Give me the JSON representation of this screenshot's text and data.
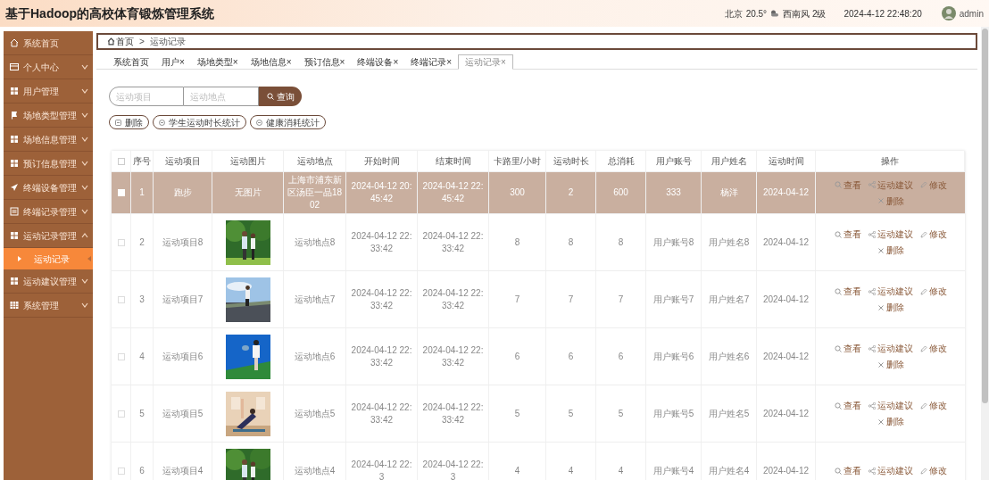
{
  "header": {
    "title": "基于Hadoop的高校体育锻炼管理系统",
    "city": "北京",
    "temperature": "20.5°",
    "wind": "西南风 2级",
    "datetime": "2024-4-12 22:48:20",
    "user": "admin"
  },
  "sidebar": {
    "items": [
      {
        "label": "系统首页"
      },
      {
        "label": "个人中心",
        "expanded": false
      },
      {
        "label": "用户管理",
        "expanded": false
      },
      {
        "label": "场地类型管理",
        "expanded": false
      },
      {
        "label": "场地信息管理",
        "expanded": false
      },
      {
        "label": "预订信息管理",
        "expanded": false
      },
      {
        "label": "终端设备管理",
        "expanded": false
      },
      {
        "label": "终端记录管理",
        "expanded": false
      },
      {
        "label": "运动记录管理",
        "expanded": true,
        "children": [
          {
            "label": "运动记录",
            "selected": true
          }
        ]
      },
      {
        "label": "运动建议管理",
        "expanded": false
      },
      {
        "label": "系统管理",
        "expanded": false
      }
    ]
  },
  "breadcrumb": [
    "首页",
    "运动记录"
  ],
  "breadcrumb_separator": ">",
  "tabs": [
    {
      "label": "系统首页",
      "selected": false
    },
    {
      "label": "用户×",
      "selected": false
    },
    {
      "label": "场地类型×",
      "selected": false
    },
    {
      "label": "场地信息×",
      "selected": false
    },
    {
      "label": "预订信息×",
      "selected": false
    },
    {
      "label": "终端设备×",
      "selected": false
    },
    {
      "label": "终端记录×",
      "selected": false
    },
    {
      "label": "运动记录×",
      "selected": true
    }
  ],
  "search": {
    "fields": [
      {
        "placeholder": "运动项目"
      },
      {
        "placeholder": "运动地点"
      }
    ],
    "button": "查询"
  },
  "actions": [
    "删除",
    "学生运动时长统计",
    "健康消耗统计"
  ],
  "table": {
    "select_all": {
      "checked": false
    },
    "columns": [
      "序号",
      "运动项目",
      "运动图片",
      "运动地点",
      "开始时间",
      "结束时间",
      "卡路里/小时",
      "运动时长",
      "总消耗",
      "用户账号",
      "用户姓名",
      "运动时间",
      "操作"
    ],
    "rows": [
      {
        "selected": true,
        "cells": [
          "1",
          "跑步",
          {
            "kind": "text",
            "text": "无图片"
          },
          "上海市浦东新区汤臣一品1802",
          "2024-04-12 20:45:42",
          "2024-04-12 22:45:42",
          "300",
          "2",
          "600",
          "333",
          "杨洋",
          "2024-04-12"
        ],
        "actions": [
          {
            "kind": "view",
            "label": "查看"
          },
          {
            "kind": "advice",
            "label": "运动建议"
          },
          {
            "kind": "edit",
            "label": "修改"
          },
          {
            "kind": "delete",
            "label": "删除"
          }
        ]
      },
      {
        "selected": false,
        "cells": [
          "2",
          "运动项目8",
          {
            "kind": "picture"
          },
          "运动地点8",
          "2024-04-12 22:33:42",
          "2024-04-12 22:33:42",
          "8",
          "8",
          "8",
          "用户账号8",
          "用户姓名8",
          "2024-04-12"
        ],
        "actions": [
          {
            "kind": "view",
            "label": "查看"
          },
          {
            "kind": "advice",
            "label": "运动建议"
          },
          {
            "kind": "edit",
            "label": "修改"
          },
          {
            "kind": "delete",
            "label": "删除"
          }
        ]
      },
      {
        "selected": false,
        "cells": [
          "3",
          "运动项目7",
          {
            "kind": "picture"
          },
          "运动地点7",
          "2024-04-12 22:33:42",
          "2024-04-12 22:33:42",
          "7",
          "7",
          "7",
          "用户账号7",
          "用户姓名7",
          "2024-04-12"
        ],
        "actions": [
          {
            "kind": "view",
            "label": "查看"
          },
          {
            "kind": "advice",
            "label": "运动建议"
          },
          {
            "kind": "edit",
            "label": "修改"
          },
          {
            "kind": "delete",
            "label": "删除"
          }
        ]
      },
      {
        "selected": false,
        "cells": [
          "4",
          "运动项目6",
          {
            "kind": "picture"
          },
          "运动地点6",
          "2024-04-12 22:33:42",
          "2024-04-12 22:33:42",
          "6",
          "6",
          "6",
          "用户账号6",
          "用户姓名6",
          "2024-04-12"
        ],
        "actions": [
          {
            "kind": "view",
            "label": "查看"
          },
          {
            "kind": "advice",
            "label": "运动建议"
          },
          {
            "kind": "edit",
            "label": "修改"
          },
          {
            "kind": "delete",
            "label": "删除"
          }
        ]
      },
      {
        "selected": false,
        "cells": [
          "5",
          "运动项目5",
          {
            "kind": "picture"
          },
          "运动地点5",
          "2024-04-12 22:33:42",
          "2024-04-12 22:33:42",
          "5",
          "5",
          "5",
          "用户账号5",
          "用户姓名5",
          "2024-04-12"
        ],
        "actions": [
          {
            "kind": "view",
            "label": "查看"
          },
          {
            "kind": "advice",
            "label": "运动建议"
          },
          {
            "kind": "edit",
            "label": "修改"
          },
          {
            "kind": "delete",
            "label": "删除"
          }
        ]
      },
      {
        "selected": false,
        "cells": [
          "6",
          "运动项目4",
          {
            "kind": "picture"
          },
          "运动地点4",
          "2024-04-12 22:3",
          "2024-04-12 22:3",
          "4",
          "4",
          "4",
          "用户账号4",
          "用户姓名4",
          "2024-04-12"
        ],
        "actions": [
          {
            "kind": "view",
            "label": "查看"
          },
          {
            "kind": "advice",
            "label": "运动建议"
          },
          {
            "kind": "edit",
            "label": "修改"
          }
        ]
      }
    ]
  }
}
